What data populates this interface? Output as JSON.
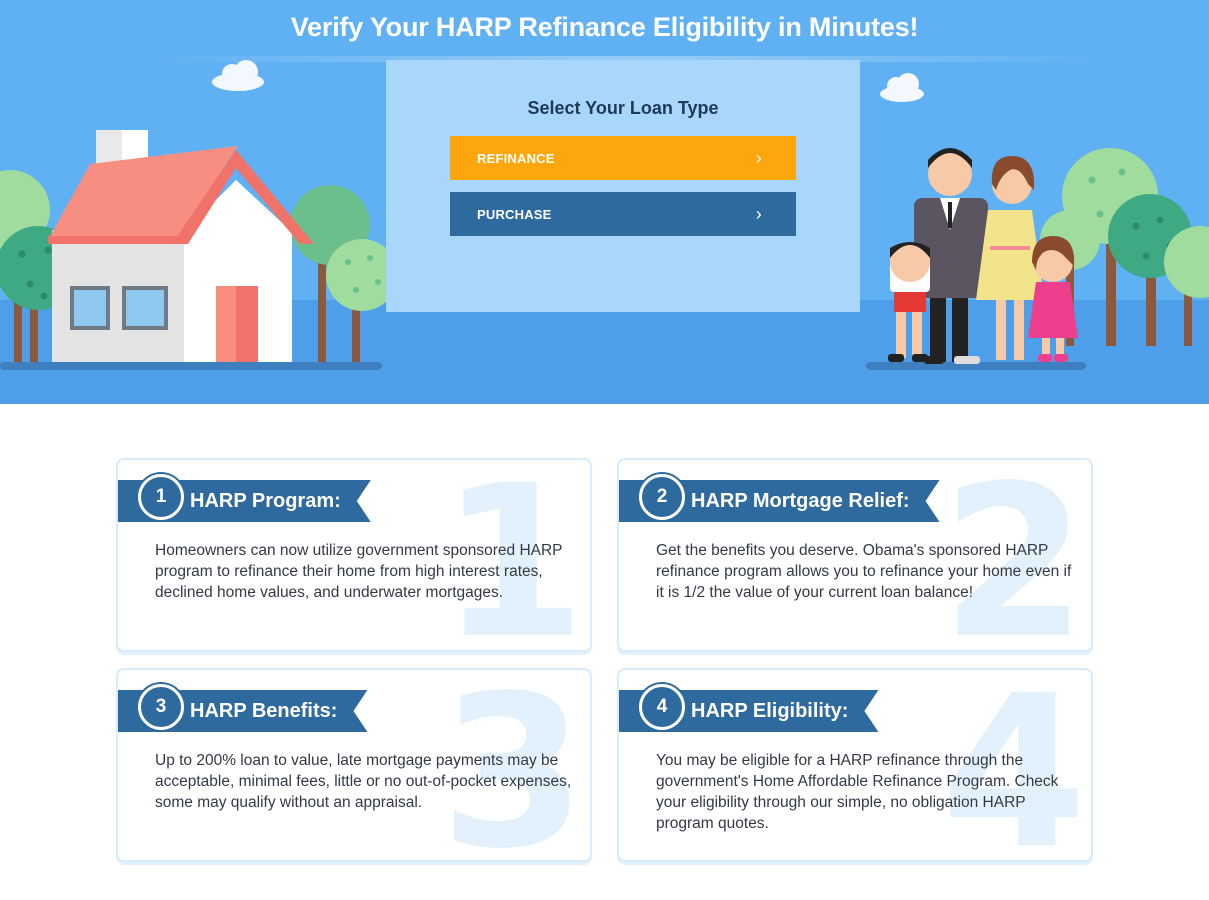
{
  "hero": {
    "title": "Verify Your HARP Refinance Eligibility in Minutes!",
    "loan_panel": {
      "heading": "Select Your Loan Type",
      "buttons": [
        {
          "label": "REFINANCE",
          "color": "#fda70d"
        },
        {
          "label": "PURCHASE",
          "color": "#2e6a9e"
        }
      ]
    }
  },
  "cards": [
    {
      "number": "1",
      "title": "HARP Program:",
      "text": "Homeowners can now utilize government sponsored HARP program to refinance their home from high interest rates, declined home values, and underwater mortgages."
    },
    {
      "number": "2",
      "title": "HARP Mortgage Relief:",
      "text": "Get the benefits you deserve. Obama's sponsored HARP refinance program allows you to refinance your home even if it is 1/2 the value of your current loan balance!"
    },
    {
      "number": "3",
      "title": "HARP Benefits:",
      "text": "Up to 200% loan to value, late mortgage payments may be acceptable, minimal fees, little or no out-of-pocket expenses, some may qualify without an appraisal."
    },
    {
      "number": "4",
      "title": "HARP Eligibility:",
      "text": "You may be eligible for a HARP refinance through the government's Home Affordable Refinance Program. Check your eligibility through our simple, no obligation HARP program quotes."
    }
  ],
  "colors": {
    "sky": "#5fb1f3",
    "accent_orange": "#fda70d",
    "brand_blue": "#2e6a9e"
  }
}
